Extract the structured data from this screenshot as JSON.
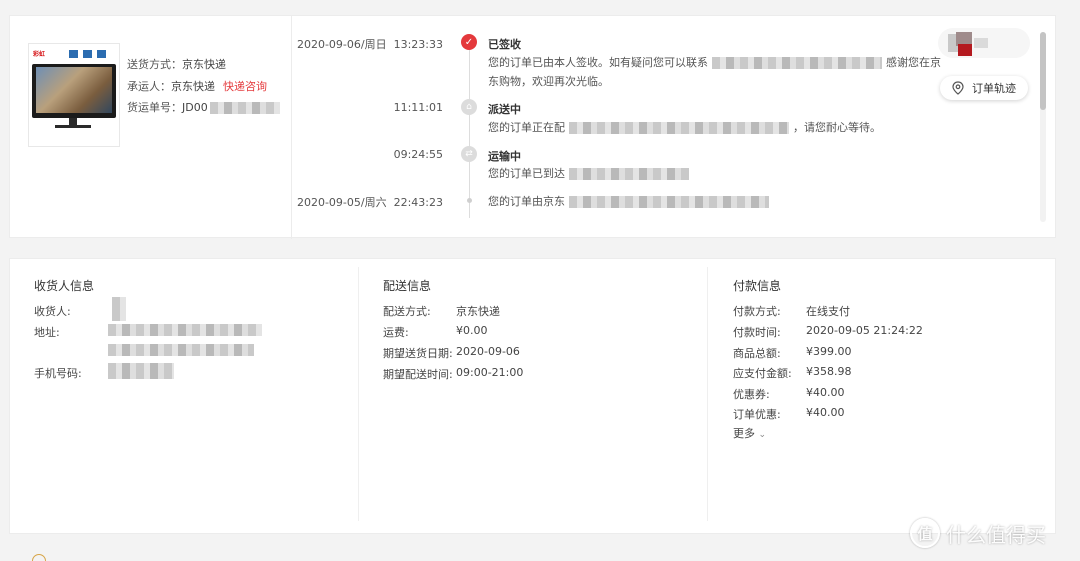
{
  "shipping": {
    "method_label": "送货方式：",
    "method_value": "京东快递",
    "carrier_label": "承运人：",
    "carrier_value": "京东快递",
    "carrier_link": "快递咨询",
    "tracking_label": "货运单号：",
    "tracking_prefix": "JD00"
  },
  "timeline": [
    {
      "date": "2020-09-06/周日",
      "time": "13:23:33",
      "status": "已签收",
      "status_icon": "check-icon",
      "desc_line1": "您的订单已由本人签收。如有疑问您可以联系",
      "desc_line1_tail": "感谢您在京",
      "desc_line2": "东购物，欢迎再次光临。"
    },
    {
      "date": "",
      "time": "11:11:01",
      "status": "派送中",
      "status_icon": "delivery-person-icon",
      "desc_prefix": "您的订单正在配",
      "desc_tail": "，请您耐心等待。"
    },
    {
      "date": "",
      "time": "09:24:55",
      "status": "运输中",
      "status_icon": "truck-icon",
      "desc_prefix": "您的订单已到达"
    },
    {
      "date": "2020-09-05/周六",
      "time": "22:43:23",
      "status": "",
      "desc_prefix": "您的订单由京东"
    }
  ],
  "track_button": "订单轨迹",
  "receiver": {
    "title": "收货人信息",
    "name_label": "收货人:",
    "address_label": "地址:",
    "phone_label": "手机号码:"
  },
  "delivery": {
    "title": "配送信息",
    "rows": [
      {
        "k": "配送方式:",
        "v": "京东快递"
      },
      {
        "k": "运费:",
        "v": "¥0.00"
      },
      {
        "k": "期望送货日期:",
        "v": "2020-09-06"
      },
      {
        "k": "期望配送时间:",
        "v": "09:00-21:00"
      }
    ]
  },
  "payment": {
    "title": "付款信息",
    "rows": [
      {
        "k": "付款方式:",
        "v": "在线支付"
      },
      {
        "k": "付款时间:",
        "v": "2020-09-05 21:24:22"
      },
      {
        "k": "商品总额:",
        "v": "¥399.00"
      },
      {
        "k": "应支付金额:",
        "v": "¥358.98"
      },
      {
        "k": "优惠券:",
        "v": "¥40.00"
      },
      {
        "k": "订单优惠:",
        "v": "¥40.00"
      }
    ],
    "more": "更多"
  },
  "watermark": {
    "logo_char": "值",
    "text": "什么值得买"
  },
  "colors": {
    "accent": "#e4393c",
    "background": "#f3f3f3",
    "card": "#ffffff"
  }
}
